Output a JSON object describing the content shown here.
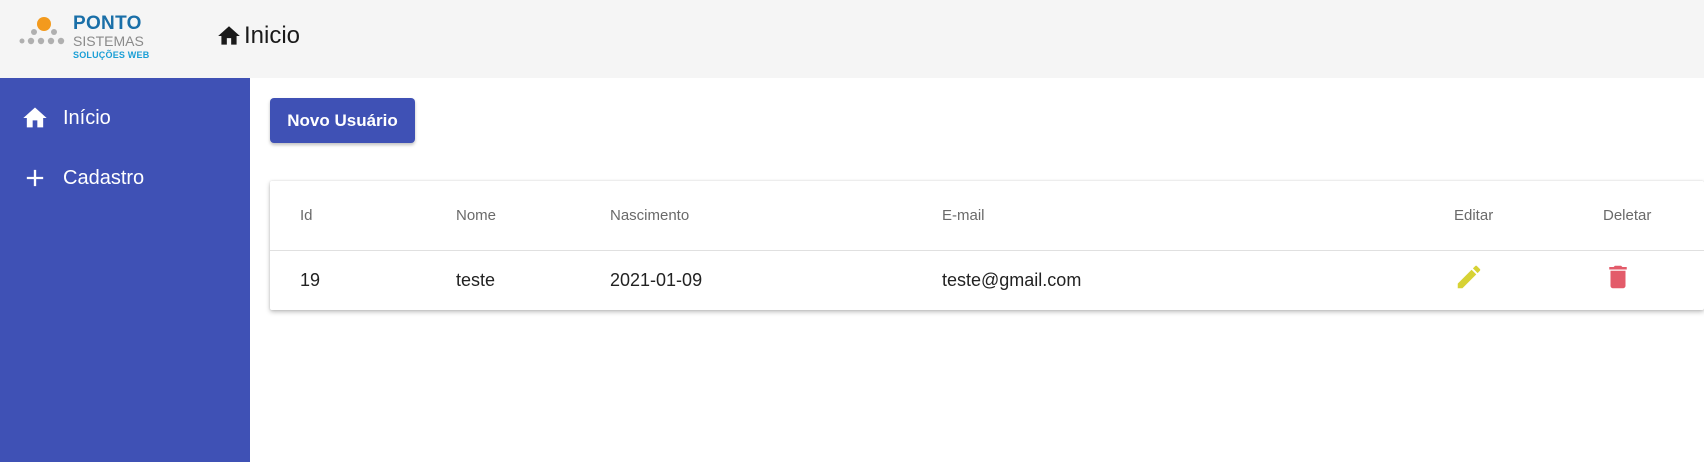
{
  "logo": {
    "line1": "PONTO",
    "line2": "SISTEMAS",
    "line3": "SOLUÇÕES WEB"
  },
  "header": {
    "title": "Inicio",
    "icon": "home-icon"
  },
  "sidebar": {
    "items": [
      {
        "label": "Início",
        "icon": "home-icon"
      },
      {
        "label": "Cadastro",
        "icon": "plus-icon"
      }
    ]
  },
  "actions": {
    "new_user_label": "Novo Usuário"
  },
  "table": {
    "columns": [
      "Id",
      "Nome",
      "Nascimento",
      "E-mail",
      "Editar",
      "Deletar"
    ],
    "rows": [
      {
        "id": "19",
        "nome": "teste",
        "nascimento": "2021-01-09",
        "email": "teste@gmail.com",
        "edit_icon": "pencil-icon",
        "delete_icon": "trash-icon"
      }
    ]
  },
  "colors": {
    "primary": "#3f51b5",
    "topbar": "#f5f5f5",
    "edit": "#d7d234",
    "delete": "#e35b6a"
  }
}
